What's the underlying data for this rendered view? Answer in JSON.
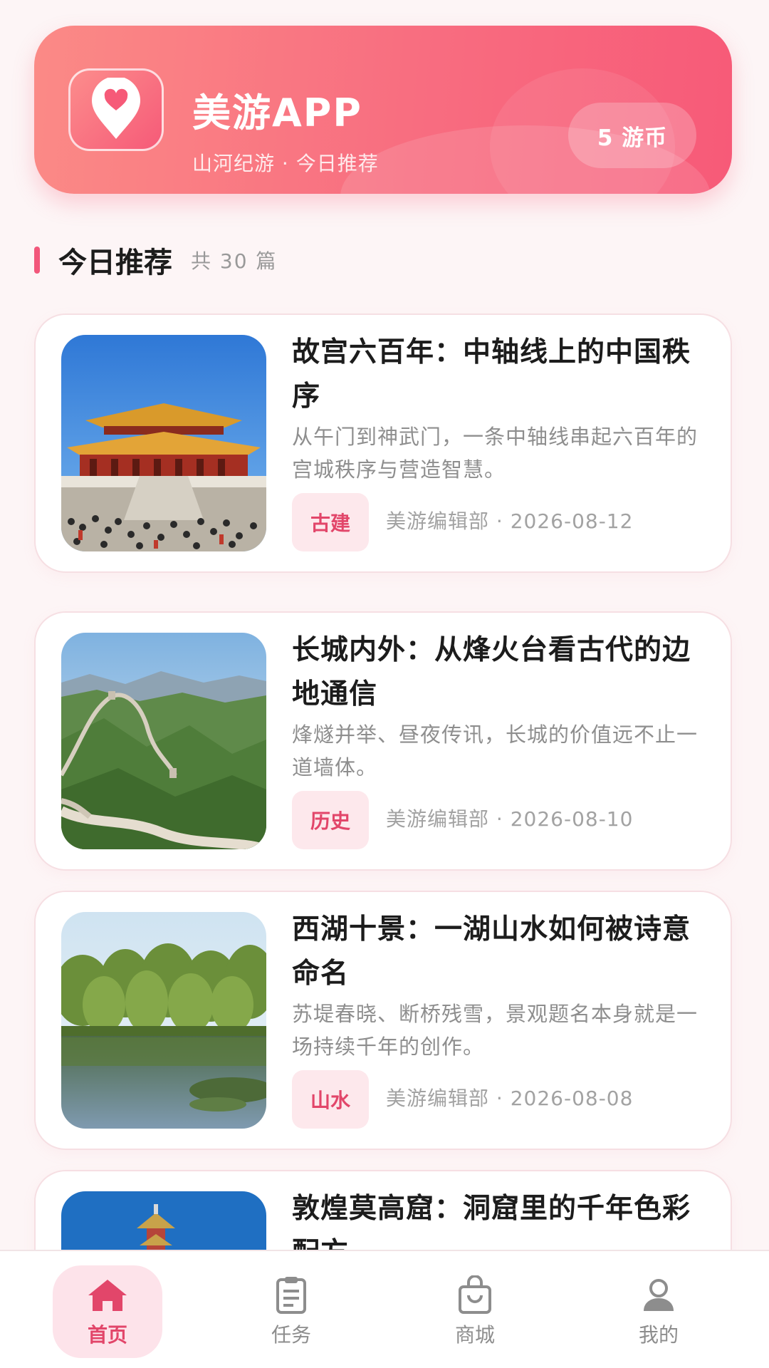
{
  "header": {
    "app_title": "美游APP",
    "subtitle": "山河纪游 · 今日推荐",
    "coins": "5 游币",
    "logo_icon": "heart-pin-icon"
  },
  "section": {
    "title": "今日推荐",
    "count": "共 30 篇"
  },
  "articles": [
    {
      "title": "故宫六百年：中轴线上的中国秩序",
      "desc": "从午门到神武门，一条中轴线串起六百年的宫城秩序与营造智慧。",
      "tag": "古建",
      "meta": "美游编辑部 · 2026-08-12",
      "image": "forbidden-city-photo"
    },
    {
      "title": "长城内外：从烽火台看古代的边地通信",
      "desc": "烽燧并举、昼夜传讯，长城的价值远不止一道墙体。",
      "tag": "历史",
      "meta": "美游编辑部 · 2026-08-10",
      "image": "great-wall-photo"
    },
    {
      "title": "西湖十景：一湖山水如何被诗意命名",
      "desc": "苏堤春晓、断桥残雪，景观题名本身就是一场持续千年的创作。",
      "tag": "山水",
      "meta": "美游编辑部 · 2026-08-08",
      "image": "west-lake-photo"
    },
    {
      "title": "敦煌莫高窟：洞窟里的千年色彩配方",
      "image": "dunhuang-photo"
    }
  ],
  "nav": {
    "items": [
      {
        "label": "首页",
        "icon": "home-icon",
        "active": true
      },
      {
        "label": "任务",
        "icon": "clipboard-icon",
        "active": false
      },
      {
        "label": "商城",
        "icon": "shopping-bag-icon",
        "active": false
      },
      {
        "label": "我的",
        "icon": "user-icon",
        "active": false
      }
    ]
  },
  "colors": {
    "accent": "#f2577b",
    "banner_start": "#fb8a86",
    "banner_end": "#f75a78",
    "tag_bg": "#fde8ec",
    "tag_text": "#e2466a"
  }
}
